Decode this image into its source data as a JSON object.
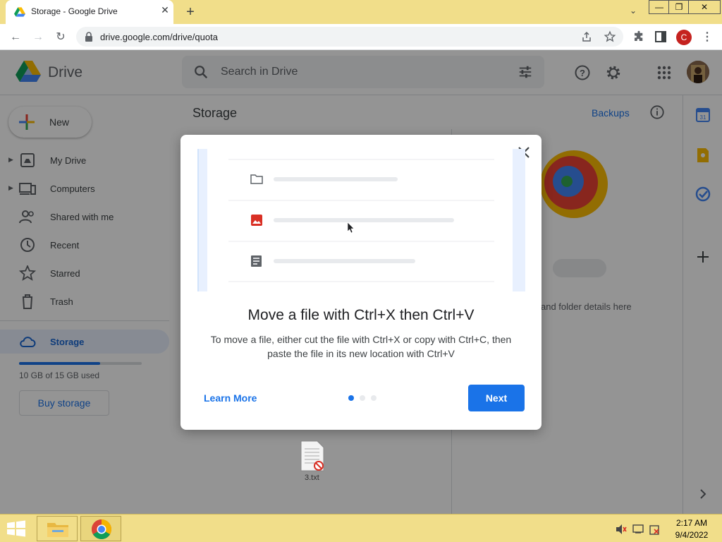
{
  "browser": {
    "tab_title": "Storage - Google Drive",
    "url": "drive.google.com/drive/quota",
    "profile_initial": "C",
    "window_buttons": [
      "—",
      "❐",
      "✕"
    ]
  },
  "drive": {
    "app_name": "Drive",
    "search_placeholder": "Search in Drive",
    "new_label": "New",
    "nav": [
      {
        "label": "My Drive",
        "icon": "my-drive-icon"
      },
      {
        "label": "Computers",
        "icon": "computers-icon"
      },
      {
        "label": "Shared with me",
        "icon": "shared-icon"
      },
      {
        "label": "Recent",
        "icon": "clock-icon"
      },
      {
        "label": "Starred",
        "icon": "star-icon"
      },
      {
        "label": "Trash",
        "icon": "trash-icon"
      }
    ],
    "storage_label": "Storage",
    "storage_used_text": "10 GB of 15 GB used",
    "storage_used_fraction": 0.66,
    "buy_storage": "Buy storage",
    "page_title": "Storage",
    "backups": "Backups",
    "details_hint": "and folder details here",
    "desktop_file": "3.txt"
  },
  "dialog": {
    "title": "Move a file with Ctrl+X then Ctrl+V",
    "body": "To move a file, either cut the file with Ctrl+X or copy with Ctrl+C, then paste the file in its new location with Ctrl+V",
    "learn_more": "Learn More",
    "next": "Next",
    "step_current": 1,
    "step_total": 3
  },
  "taskbar": {
    "time": "2:17 AM",
    "date": "9/4/2022"
  },
  "colors": {
    "accent": "#1a73e8",
    "chrome_frame": "#f1de8a"
  }
}
